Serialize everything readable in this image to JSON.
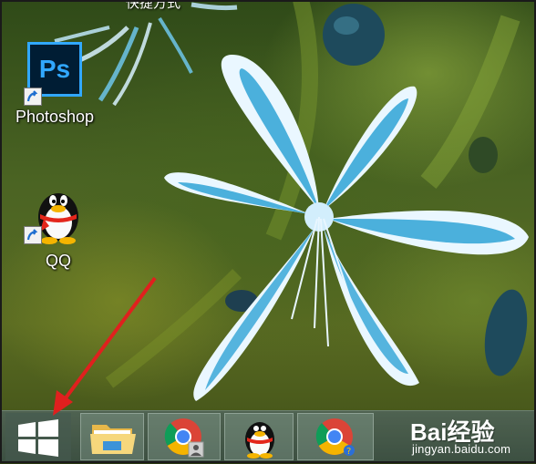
{
  "desktop": {
    "top_cut_label": "快捷方式",
    "icons": [
      {
        "label": "Photoshop",
        "logo_text": "Ps",
        "icon": "photoshop-icon"
      },
      {
        "label": "QQ",
        "icon": "qq-penguin-icon"
      }
    ]
  },
  "taskbar": {
    "items": [
      {
        "name": "start",
        "icon": "windows-logo-icon"
      },
      {
        "name": "file-explorer",
        "icon": "folder-icon"
      },
      {
        "name": "chrome",
        "icon": "chrome-icon"
      },
      {
        "name": "qq",
        "icon": "qq-penguin-icon"
      },
      {
        "name": "chrome-second",
        "icon": "chrome-icon"
      }
    ]
  },
  "watermark": {
    "brand": "Bai经验",
    "url": "jingyan.baidu.com"
  },
  "colors": {
    "flower_blue": "#2fa3d6",
    "arrow_red": "#e0201e",
    "ps_blue": "#31a8ff",
    "ps_bg": "#001d34"
  }
}
